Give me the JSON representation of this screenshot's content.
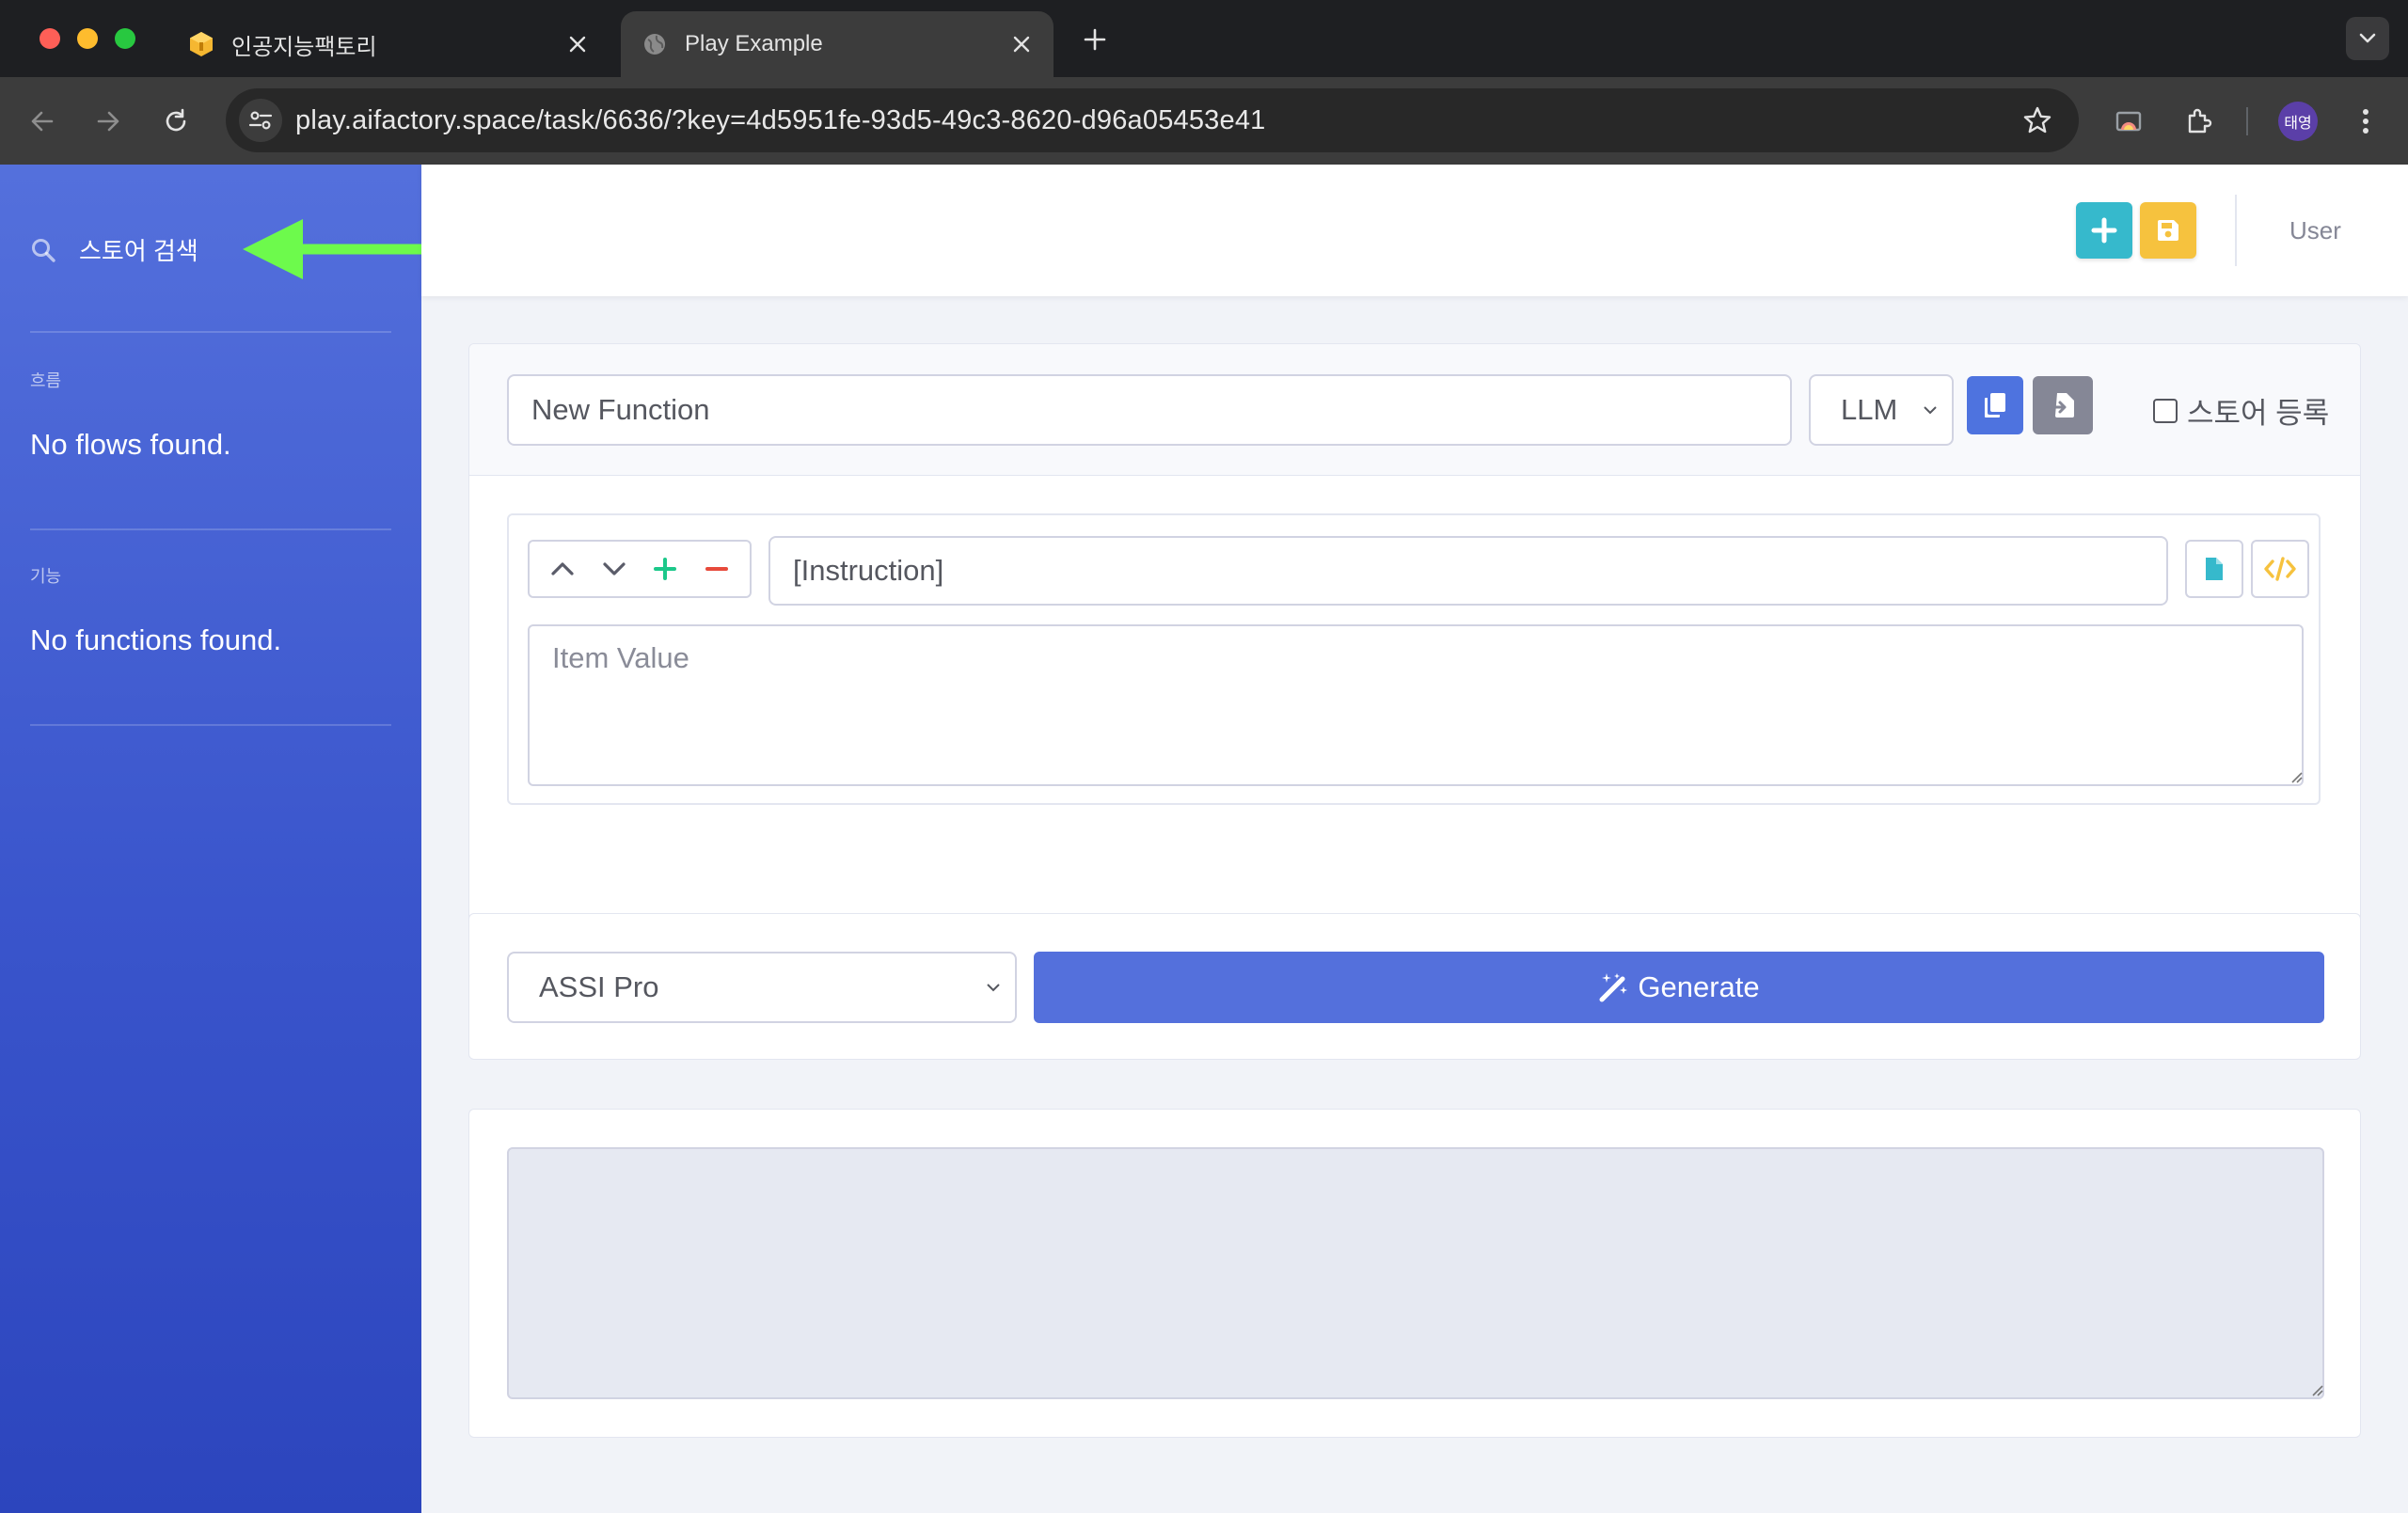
{
  "browser": {
    "tabs": [
      {
        "title": "인공지능팩토리",
        "active": false
      },
      {
        "title": "Play Example",
        "active": true
      }
    ],
    "url": "play.aifactory.space/task/6636/?key=4d5951fe-93d5-49c3-8620-d96a05453e41",
    "profile_initials": "태영"
  },
  "sidebar": {
    "search_label": "스토어 검색",
    "sections": [
      {
        "heading": "흐름",
        "empty_text": "No flows found."
      },
      {
        "heading": "기능",
        "empty_text": "No functions found."
      }
    ]
  },
  "topnav": {
    "user_label": "User"
  },
  "function_editor": {
    "name_value": "New Function",
    "type_selected": "LLM",
    "store_register_label": "스토어 등록",
    "store_register_checked": false,
    "item": {
      "key_value": "[Instruction]",
      "value_placeholder": "Item Value"
    }
  },
  "generate_panel": {
    "model_selected": "ASSI Pro",
    "generate_label": "Generate"
  },
  "output_panel": {
    "value": ""
  },
  "colors": {
    "primary": "#4e73df",
    "info": "#36b9cc",
    "warning": "#f6c23e",
    "secondary": "#858796",
    "success": "#1cc88a",
    "danger": "#e74a3b",
    "arrow_annotation": "#6dfa4c"
  },
  "icons": [
    "search-icon",
    "plus-icon",
    "save-icon",
    "copy-icon",
    "import-icon",
    "chevron-up-icon",
    "chevron-down-icon",
    "minus-icon",
    "file-icon",
    "code-icon",
    "magic-wand-icon",
    "star-icon",
    "extension-icon"
  ]
}
